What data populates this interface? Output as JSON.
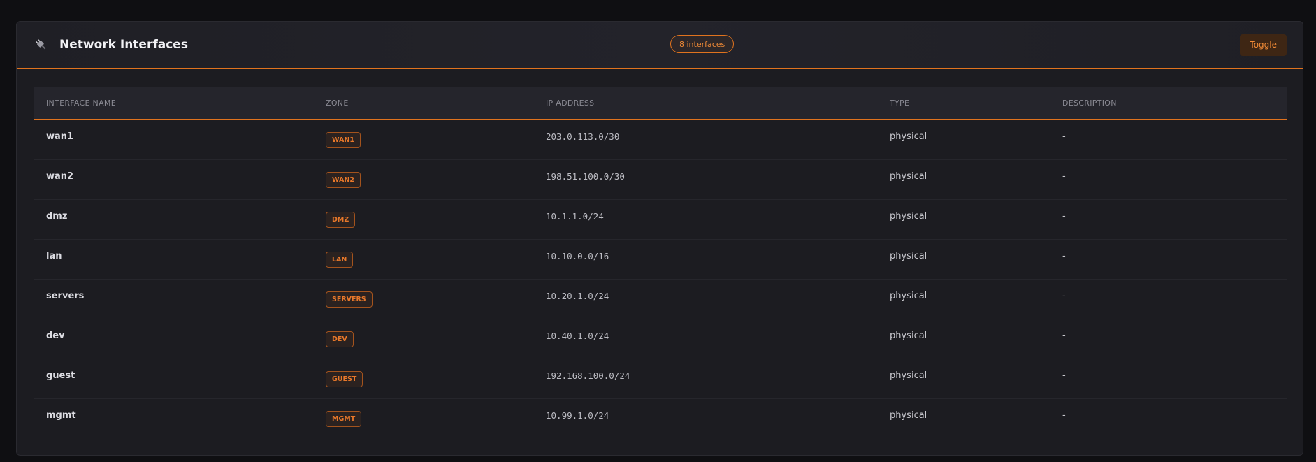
{
  "panel": {
    "title": "Network Interfaces",
    "icon": "plug-icon",
    "count_badge": "8 interfaces",
    "toggle_label": "Toggle"
  },
  "colors": {
    "accent": "#e0731e",
    "background": "#0f0f12",
    "panel": "#1c1c21"
  },
  "table": {
    "columns": [
      "INTERFACE NAME",
      "ZONE",
      "IP ADDRESS",
      "TYPE",
      "DESCRIPTION"
    ],
    "rows": [
      {
        "name": "wan1",
        "zone": "WAN1",
        "ip": "203.0.113.0/30",
        "type": "physical",
        "description": "-"
      },
      {
        "name": "wan2",
        "zone": "WAN2",
        "ip": "198.51.100.0/30",
        "type": "physical",
        "description": "-"
      },
      {
        "name": "dmz",
        "zone": "DMZ",
        "ip": "10.1.1.0/24",
        "type": "physical",
        "description": "-"
      },
      {
        "name": "lan",
        "zone": "LAN",
        "ip": "10.10.0.0/16",
        "type": "physical",
        "description": "-"
      },
      {
        "name": "servers",
        "zone": "SERVERS",
        "ip": "10.20.1.0/24",
        "type": "physical",
        "description": "-"
      },
      {
        "name": "dev",
        "zone": "DEV",
        "ip": "10.40.1.0/24",
        "type": "physical",
        "description": "-"
      },
      {
        "name": "guest",
        "zone": "GUEST",
        "ip": "192.168.100.0/24",
        "type": "physical",
        "description": "-"
      },
      {
        "name": "mgmt",
        "zone": "MGMT",
        "ip": "10.99.1.0/24",
        "type": "physical",
        "description": "-"
      }
    ]
  }
}
